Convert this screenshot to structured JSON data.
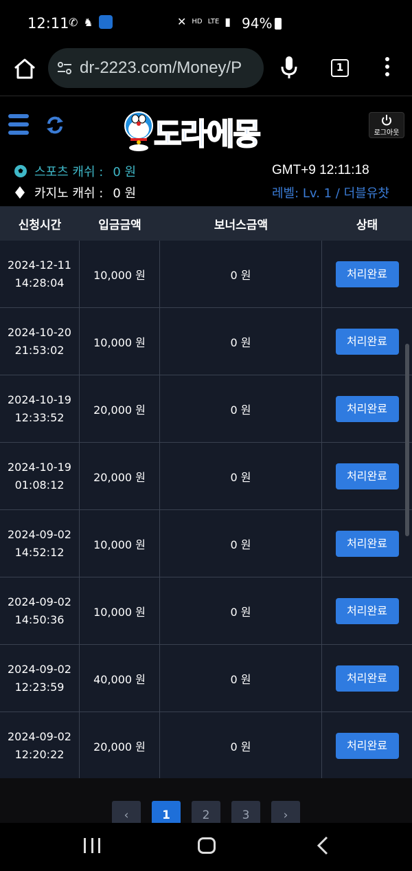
{
  "status_bar": {
    "time": "12:11",
    "network": "LTE",
    "battery": "94%"
  },
  "browser": {
    "url": "dr-2223.com/Money/P",
    "tab_count": "1"
  },
  "site": {
    "logo_text": "도라에몽",
    "logout_label": "로그아웃",
    "sports_label": "스포츠 캐쉬 :",
    "sports_value": "0 원",
    "casino_label": "카지노 캐쉬 :",
    "casino_value": "0 원",
    "clock": "GMT+9 12:11:18",
    "level": "레벨: Lv. 1 / 더블유챳"
  },
  "table": {
    "headers": [
      "신청시간",
      "입금금액",
      "보너스금액",
      "상태"
    ],
    "rows": [
      {
        "date": "2024-12-11",
        "time": "14:28:04",
        "amount": "10,000 원",
        "bonus": "0 원",
        "status": "처리완료"
      },
      {
        "date": "2024-10-20",
        "time": "21:53:02",
        "amount": "10,000 원",
        "bonus": "0 원",
        "status": "처리완료"
      },
      {
        "date": "2024-10-19",
        "time": "12:33:52",
        "amount": "20,000 원",
        "bonus": "0 원",
        "status": "처리완료"
      },
      {
        "date": "2024-10-19",
        "time": "01:08:12",
        "amount": "20,000 원",
        "bonus": "0 원",
        "status": "처리완료"
      },
      {
        "date": "2024-09-02",
        "time": "14:52:12",
        "amount": "10,000 원",
        "bonus": "0 원",
        "status": "처리완료"
      },
      {
        "date": "2024-09-02",
        "time": "14:50:36",
        "amount": "10,000 원",
        "bonus": "0 원",
        "status": "처리완료"
      },
      {
        "date": "2024-09-02",
        "time": "12:23:59",
        "amount": "40,000 원",
        "bonus": "0 원",
        "status": "처리완료"
      },
      {
        "date": "2024-09-02",
        "time": "12:20:22",
        "amount": "20,000 원",
        "bonus": "0 원",
        "status": "처리완료"
      }
    ]
  },
  "pagination": {
    "prev": "‹",
    "pages": [
      "1",
      "2",
      "3"
    ],
    "next": "›",
    "active_page": "1"
  },
  "colors": {
    "accent": "#1e6fd9",
    "button": "#2f7be0",
    "table_bg": "#151b28",
    "header_bg": "#222936",
    "sports_color": "#3fb8c8"
  }
}
